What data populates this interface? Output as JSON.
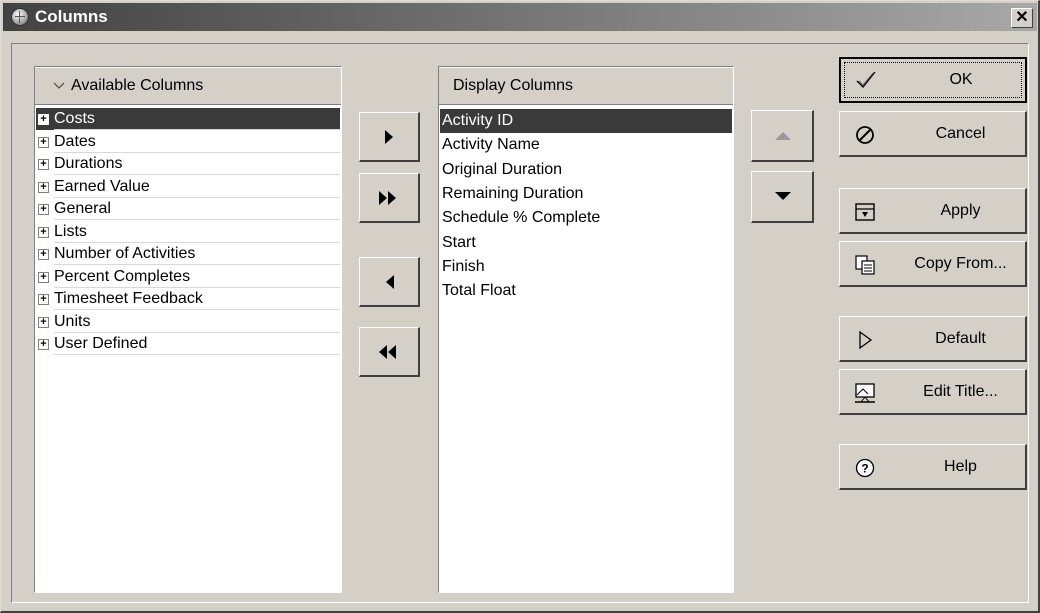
{
  "window": {
    "title": "Columns",
    "close_glyph": "✕"
  },
  "available": {
    "header": "Available Columns",
    "header_icon": "chevron-down-icon",
    "items": [
      "Costs",
      "Dates",
      "Durations",
      "Earned Value",
      "General",
      "Lists",
      "Number of Activities",
      "Percent Completes",
      "Timesheet Feedback",
      "Units",
      "User Defined"
    ],
    "selected_index": 0
  },
  "display": {
    "header": "Display Columns",
    "items": [
      "Activity ID",
      "Activity Name",
      "Original Duration",
      "Remaining Duration",
      "Schedule % Complete",
      "Start",
      "Finish",
      "Total Float"
    ],
    "selected_index": 0
  },
  "transfer_buttons": [
    "move-right",
    "move-all-right",
    "move-left",
    "move-all-left"
  ],
  "order_buttons": {
    "up_enabled": false,
    "down_enabled": true
  },
  "actions": {
    "ok": "OK",
    "cancel": "Cancel",
    "apply": "Apply",
    "copy_from": "Copy From...",
    "default": "Default",
    "edit_title": "Edit Title...",
    "help": "Help"
  },
  "colors": {
    "selection": "#3a3a3a",
    "face": "#d4d0c8"
  }
}
